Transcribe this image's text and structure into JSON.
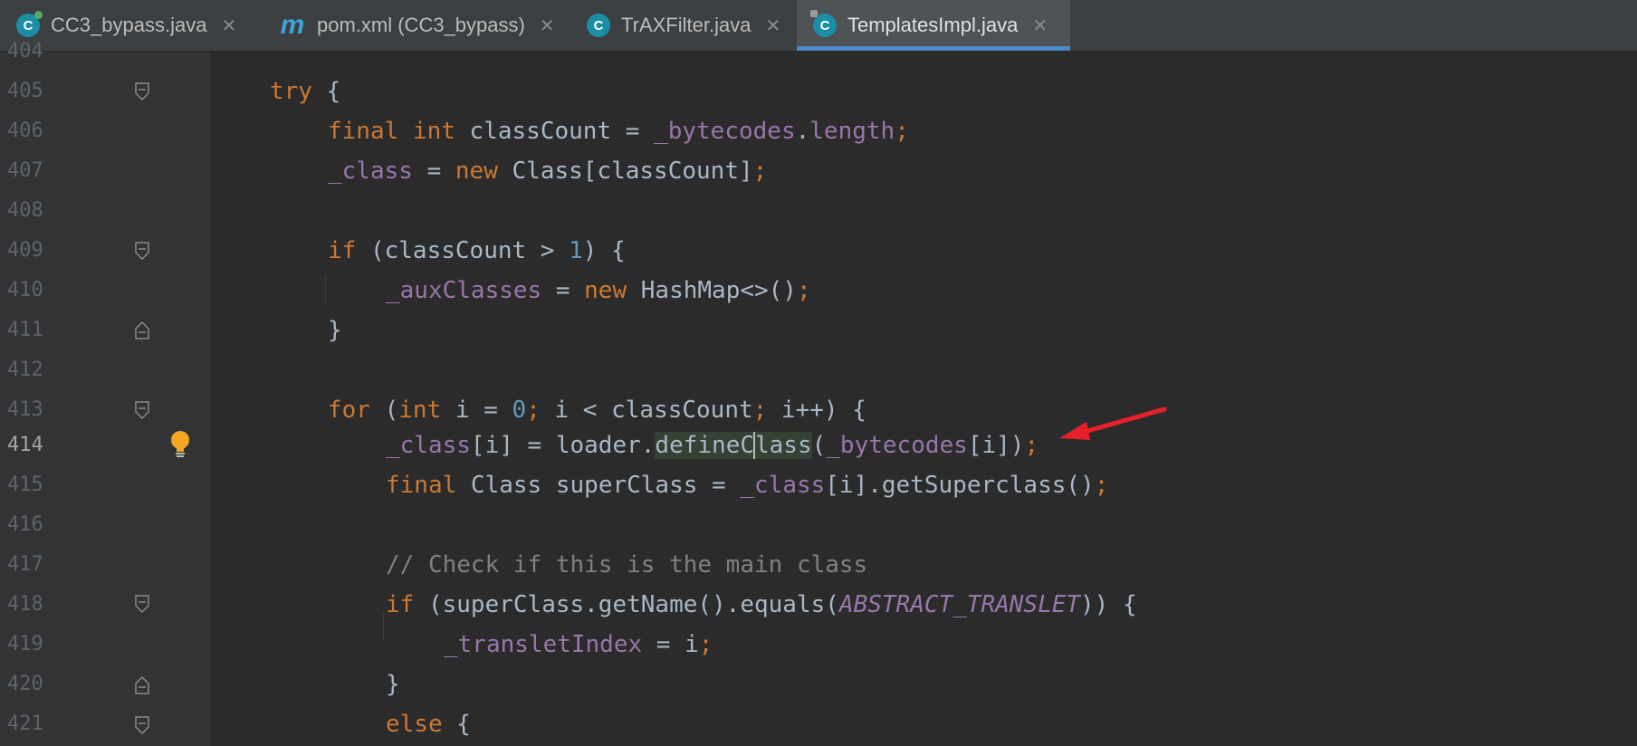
{
  "tabs": [
    {
      "label": "CC3_bypass.java",
      "icon": "class-run-icon",
      "active": false
    },
    {
      "label": "pom.xml (CC3_bypass)",
      "icon": "maven-m-icon",
      "active": false
    },
    {
      "label": "TrAXFilter.java",
      "icon": "class-icon",
      "active": false
    },
    {
      "label": "TemplatesImpl.java",
      "icon": "class-locked-icon",
      "active": true
    }
  ],
  "gutter": {
    "lines": [
      "404",
      "405",
      "406",
      "407",
      "408",
      "409",
      "410",
      "411",
      "412",
      "413",
      "414",
      "415",
      "416",
      "417",
      "418",
      "419",
      "420",
      "421"
    ]
  },
  "code": {
    "l405_kw": "try",
    "l405_rest": " {",
    "l406_kw1": "final",
    "l406_kw2": "int",
    "l406_a": " classCount = ",
    "l406_fld": "_bytecodes",
    "l406_b": ".",
    "l406_fld2": "length",
    "l406_semi": ";",
    "l407_fld": "_class",
    "l407_a": " = ",
    "l407_kw": "new",
    "l407_b": " Class[classCount]",
    "l407_semi": ";",
    "l409_kw": "if",
    "l409_a": " (classCount > ",
    "l409_num": "1",
    "l409_b": ") {",
    "l410_fld": "_auxClasses",
    "l410_a": " = ",
    "l410_kw": "new",
    "l410_b": " HashMap<>()",
    "l410_semi": ";",
    "l411": "}",
    "l413_kw": "for",
    "l413_a": " (",
    "l413_kw2": "int",
    "l413_b": " i = ",
    "l413_num": "0",
    "l413_semi1": ";",
    "l413_c": " i < classCount",
    "l413_semi2": ";",
    "l413_d": " i++) {",
    "l414_fld": "_class",
    "l414_a": "[i] = loader.",
    "l414_hl1": "defineC",
    "l414_hl2": "lass",
    "l414_b": "(",
    "l414_fld2": "_bytecodes",
    "l414_c": "[i])",
    "l414_semi": ";",
    "l415_kw": "final",
    "l415_a": " Class superClass = ",
    "l415_fld": "_class",
    "l415_b": "[i].getSuperclass()",
    "l415_semi": ";",
    "l417_cmt": "// Check if this is the main class",
    "l418_kw": "if",
    "l418_a": " (superClass.getName().equals(",
    "l418_cst": "ABSTRACT_TRANSLET",
    "l418_b": ")) {",
    "l419_fld": "_transletIndex",
    "l419_a": " = i",
    "l419_semi": ";",
    "l420": "}",
    "l421_kw": "else",
    "l421_a": " {"
  },
  "colors": {
    "keyword": "#cc7832",
    "field": "#9876aa",
    "number": "#6897bb",
    "comment": "#808080",
    "arrow": "#e8202a",
    "bulb": "#f5a623"
  }
}
